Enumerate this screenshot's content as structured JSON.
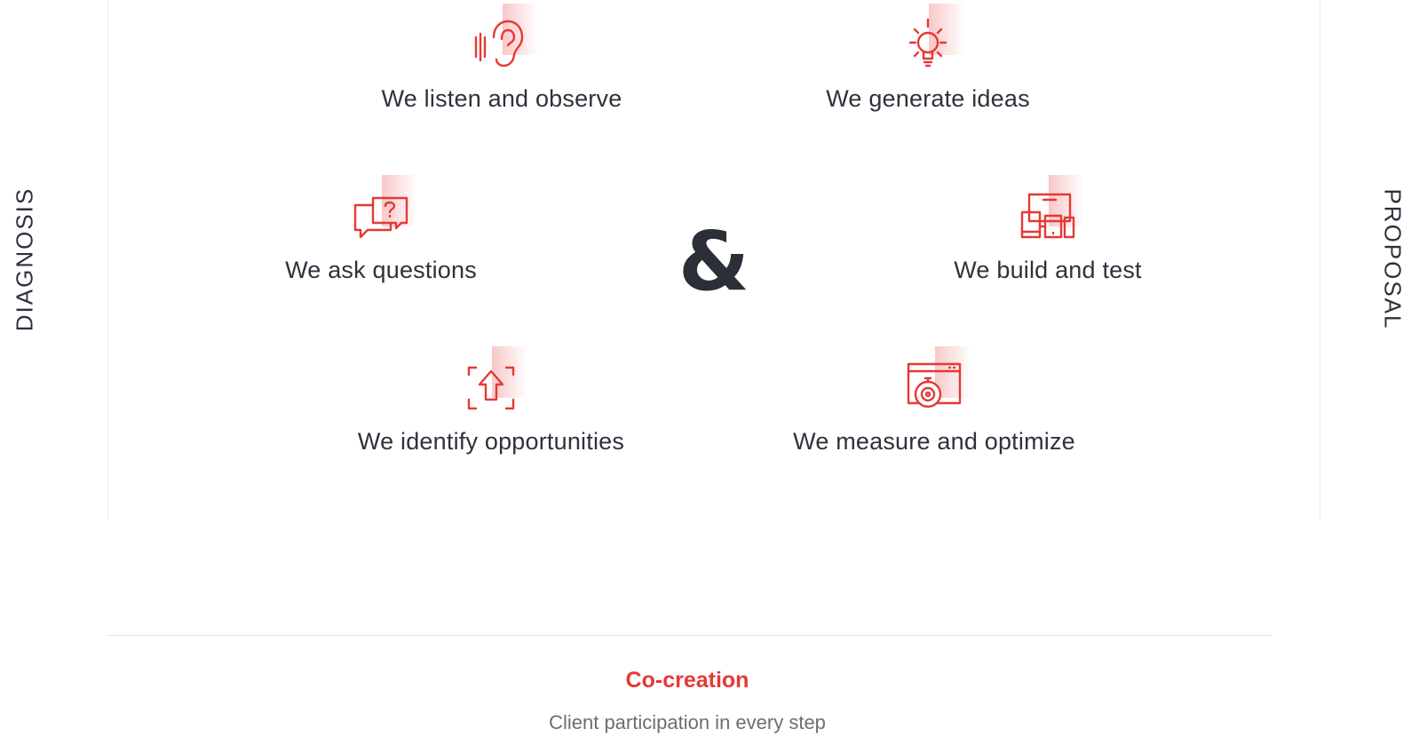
{
  "side_labels": {
    "left": "DIAGNOSIS",
    "right": "PROPOSAL"
  },
  "center_symbol": "&",
  "accent_color": "#e53935",
  "steps": [
    {
      "label": "We listen and observe",
      "icon": "ear-listening-icon"
    },
    {
      "label": "We generate ideas",
      "icon": "lightbulb-icon"
    },
    {
      "label": "We ask questions",
      "icon": "question-chat-icon"
    },
    {
      "label": "We build and test",
      "icon": "devices-icon"
    },
    {
      "label": "We identify opportunities",
      "icon": "focus-arrow-up-icon"
    },
    {
      "label": "We measure and optimize",
      "icon": "browser-dial-icon"
    }
  ],
  "footer": {
    "title": "Co-creation",
    "subtitle": "Client participation in every step"
  }
}
